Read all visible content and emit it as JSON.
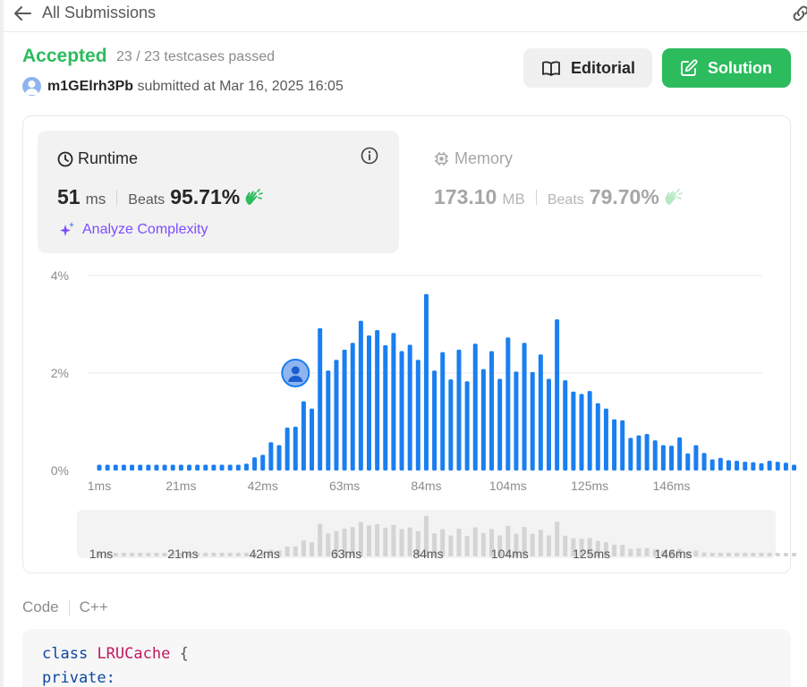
{
  "nav": {
    "back_label": "All Submissions"
  },
  "submission": {
    "status": "Accepted",
    "testcases": "23 / 23 testcases passed",
    "username": "m1GElrh3Pb",
    "submitted_text": "submitted at Mar 16, 2025 16:05"
  },
  "buttons": {
    "editorial": "Editorial",
    "solution": "Solution"
  },
  "runtime": {
    "title": "Runtime",
    "value": "51",
    "unit": "ms",
    "beats_label": "Beats",
    "beats_pct": "95.71%",
    "analyze_label": "Analyze Complexity"
  },
  "memory": {
    "title": "Memory",
    "value": "173.10",
    "unit": "MB",
    "beats_label": "Beats",
    "beats_pct": "79.70%"
  },
  "code": {
    "label": "Code",
    "language": "C++",
    "line1_kw": "class",
    "line1_name": "LRUCache",
    "line1_brace": "{",
    "line2": "private:"
  },
  "colors": {
    "accepted": "#2cbb5d",
    "bar": "#1a7ff0",
    "analyze": "#7c4dff",
    "overview_bar": "#d4d4d4"
  },
  "chart_data": {
    "type": "bar",
    "title": "",
    "xlabel": "",
    "ylabel": "",
    "ylim": [
      0,
      4
    ],
    "y_ticks": [
      "0%",
      "2%",
      "4%"
    ],
    "x_tick_labels": [
      "1ms",
      "21ms",
      "42ms",
      "63ms",
      "84ms",
      "104ms",
      "125ms",
      "146ms"
    ],
    "x_tick_bar_index": [
      0,
      10,
      20,
      30,
      40,
      50,
      60,
      70
    ],
    "highlight_bar_index": 24,
    "highlight_value": 2.0,
    "values": [
      0.12,
      0.12,
      0.12,
      0.12,
      0.12,
      0.12,
      0.12,
      0.12,
      0.12,
      0.12,
      0.12,
      0.12,
      0.12,
      0.12,
      0.12,
      0.12,
      0.12,
      0.12,
      0.14,
      0.27,
      0.32,
      0.58,
      0.52,
      0.88,
      0.9,
      1.42,
      1.27,
      2.92,
      2.05,
      2.27,
      2.48,
      2.62,
      3.07,
      2.77,
      2.88,
      2.57,
      2.82,
      2.45,
      2.58,
      2.27,
      3.62,
      2.05,
      2.43,
      1.87,
      2.48,
      1.83,
      2.6,
      2.08,
      2.45,
      1.88,
      2.73,
      2.03,
      2.62,
      2.02,
      2.38,
      1.88,
      3.1,
      1.85,
      1.62,
      1.57,
      1.63,
      1.38,
      1.27,
      1.05,
      1.03,
      0.67,
      0.72,
      0.75,
      0.62,
      0.52,
      0.51,
      0.68,
      0.35,
      0.52,
      0.36,
      0.23,
      0.26,
      0.21,
      0.2,
      0.18,
      0.17,
      0.15,
      0.2,
      0.18,
      0.16,
      0.12
    ]
  }
}
